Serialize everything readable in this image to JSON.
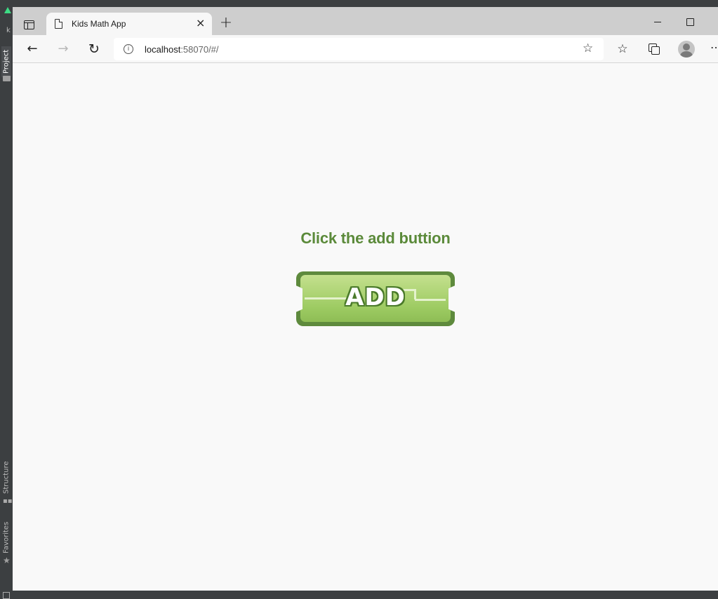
{
  "ide": {
    "letter": "k",
    "tabs": {
      "project": "Project",
      "structure": "Structure",
      "favorites": "Favorites"
    }
  },
  "browser": {
    "tab_title": "Kids Math App",
    "url_host": "localhost",
    "url_rest": ":58070/#/"
  },
  "page": {
    "prompt": "Click the add buttion",
    "add_label": "ADD"
  },
  "colors": {
    "prompt_green": "#5b8a3a",
    "button_border": "#5e8a3d",
    "button_fill": "#9dcb62"
  }
}
